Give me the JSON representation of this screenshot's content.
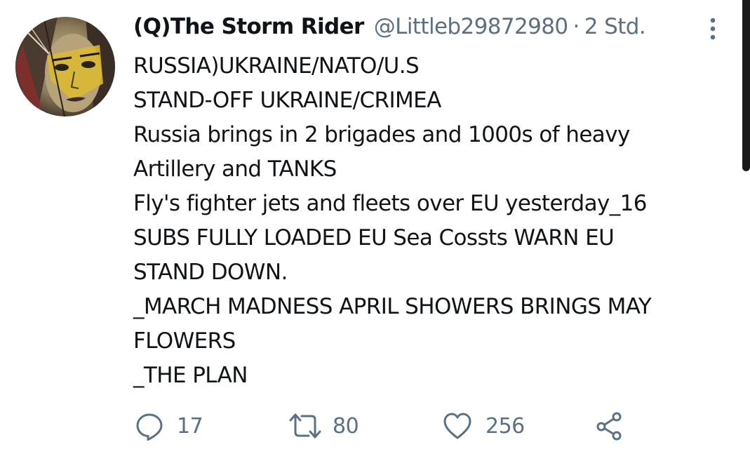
{
  "tweet": {
    "name": "(Q)The Storm Rider",
    "handle": "@Littleb29872980",
    "separator": "·",
    "time": "2 Std.",
    "lines": [
      "RUSSIA)UKRAINE/NATO/U.S",
      "STAND-OFF UKRAINE/CRIMEA",
      "Russia brings in 2 brigades and 1000s of heavy",
      "Artillery and TANKS",
      "Fly's fighter jets and fleets over EU yesterday_16",
      "SUBS FULLY LOADED EU Sea Cossts WARN EU",
      "STAND DOWN.",
      "_MARCH MADNESS APRIL SHOWERS BRINGS MAY",
      "FLOWERS",
      "_THE PLAN"
    ]
  },
  "actions": {
    "reply": {
      "icon": "reply-icon",
      "count": "17"
    },
    "retweet": {
      "icon": "retweet-icon",
      "count": "80"
    },
    "like": {
      "icon": "heart-icon",
      "count": "256"
    },
    "share": {
      "icon": "share-icon"
    }
  },
  "menu": {
    "icon": "more-vertical-icon"
  },
  "colors": {
    "text": "#0f1419",
    "secondary": "#5b7083",
    "icon": "#5b7083",
    "background": "#ffffff"
  }
}
